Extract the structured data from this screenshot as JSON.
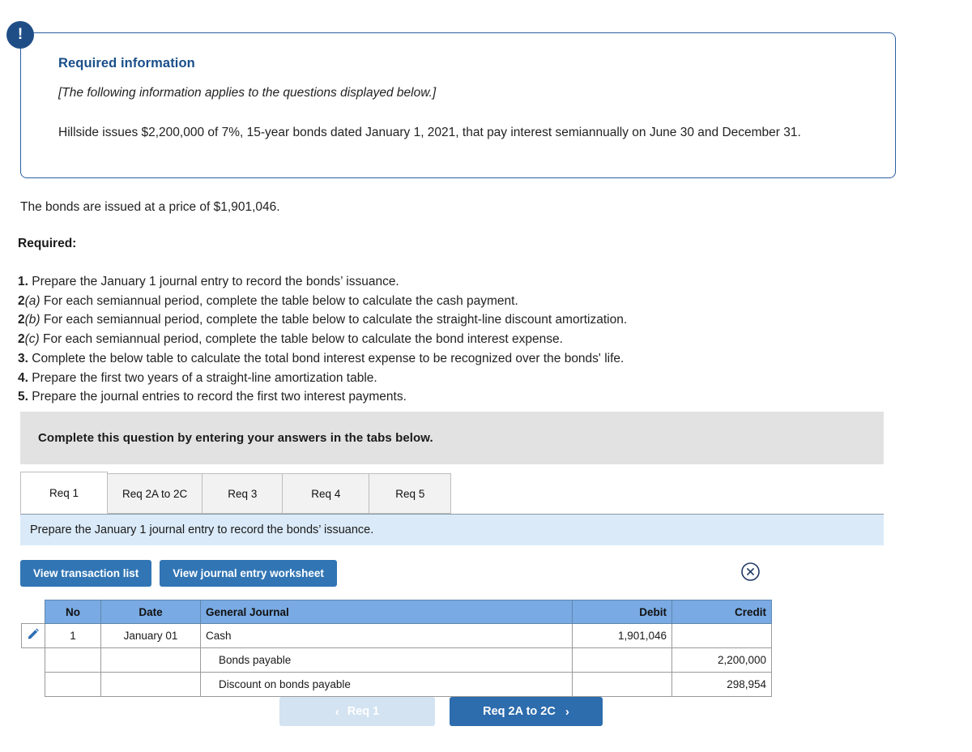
{
  "colors": {
    "accent_blue": "#3175b4",
    "callout_border": "#2b5ea3",
    "callout_title": "#1a4f8a",
    "table_header_blue": "#79aae3",
    "instruction_bar": "#daeaf8",
    "grey_banner": "#e2e2e2",
    "nav_next": "#2d6cad",
    "nav_prev_disabled": "#d3e3f1"
  },
  "callout": {
    "icon": "exclamation-icon",
    "title": "Required information",
    "italic_note": "[The following information applies to the questions displayed below.]",
    "body": "Hillside issues $2,200,000 of 7%, 15-year bonds dated January 1, 2021, that pay interest semiannually on June 30 and December 31."
  },
  "intro": {
    "issue_price": "The bonds are issued at a price of $1,901,046.",
    "required_label": "Required:"
  },
  "requirements": [
    {
      "num": "1.",
      "ital": "",
      "text": " Prepare the January 1 journal entry to record the bonds’ issuance."
    },
    {
      "num": "2",
      "ital": "(a)",
      "text": " For each semiannual period, complete the table below to calculate the cash payment."
    },
    {
      "num": "2",
      "ital": "(b)",
      "text": " For each semiannual period, complete the table below to calculate the straight-line discount amortization."
    },
    {
      "num": "2",
      "ital": "(c)",
      "text": " For each semiannual period, complete the table below to calculate the bond interest expense."
    },
    {
      "num": "3.",
      "ital": "",
      "text": " Complete the below table to calculate the total bond interest expense to be recognized over the bonds' life."
    },
    {
      "num": "4.",
      "ital": "",
      "text": " Prepare the first two years of a straight-line amortization table."
    },
    {
      "num": "5.",
      "ital": "",
      "text": " Prepare the journal entries to record the first two interest payments."
    }
  ],
  "banner": {
    "text": "Complete this question by entering your answers in the tabs below."
  },
  "tabs": [
    {
      "label": "Req 1",
      "active": true
    },
    {
      "label": "Req 2A to 2C",
      "active": false
    },
    {
      "label": "Req 3",
      "active": false
    },
    {
      "label": "Req 4",
      "active": false
    },
    {
      "label": "Req 5",
      "active": false
    }
  ],
  "instruction": {
    "text": "Prepare the January 1 journal entry to record the bonds’ issuance."
  },
  "actions": {
    "view_transaction_list": "View transaction list",
    "view_journal_entry_worksheet": "View journal entry worksheet",
    "close_icon": "close-circle-icon"
  },
  "journal": {
    "columns": [
      "No",
      "Date",
      "General Journal",
      "Debit",
      "Credit"
    ],
    "rows": [
      {
        "edit_icon": "pencil-icon",
        "no": "1",
        "date": "January 01",
        "account": "Cash",
        "indent": false,
        "debit": "1,901,046",
        "credit": ""
      },
      {
        "edit_icon": "",
        "no": "",
        "date": "",
        "account": "Bonds payable",
        "indent": true,
        "debit": "",
        "credit": "2,200,000"
      },
      {
        "edit_icon": "",
        "no": "",
        "date": "",
        "account": "Discount on bonds payable",
        "indent": true,
        "debit": "",
        "credit": "298,954"
      }
    ]
  },
  "nav": {
    "prev_label": "Req 1",
    "prev_chevron": "‹",
    "next_label": "Req 2A to 2C",
    "next_chevron": "›"
  }
}
